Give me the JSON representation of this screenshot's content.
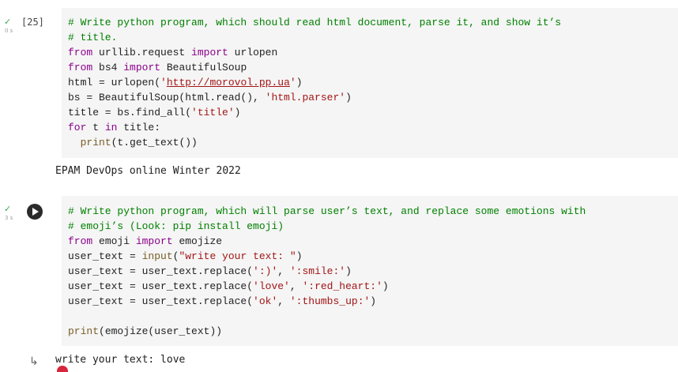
{
  "cell1": {
    "status_icon": "check-icon",
    "exec_time": "0 s",
    "exec_count": "[25]",
    "code": [
      [
        [
          "cm",
          "# Write python program, which should read html document, parse it, and show it’s"
        ]
      ],
      [
        [
          "cm",
          "# title."
        ]
      ],
      [
        [
          "kw",
          "from"
        ],
        [
          "",
          " urllib.request "
        ],
        [
          "kw",
          "import"
        ],
        [
          "",
          " urlopen"
        ]
      ],
      [
        [
          "kw",
          "from"
        ],
        [
          "",
          " bs4 "
        ],
        [
          "kw",
          "import"
        ],
        [
          "",
          " BeautifulSoup"
        ]
      ],
      [
        [
          "",
          "html = urlopen("
        ],
        [
          "st",
          "'"
        ],
        [
          "url",
          "http://morovol.pp.ua"
        ],
        [
          "st",
          "'"
        ],
        [
          "",
          ")"
        ]
      ],
      [
        [
          "",
          "bs = BeautifulSoup(html.read(), "
        ],
        [
          "st",
          "'html.parser'"
        ],
        [
          "",
          ")"
        ]
      ],
      [
        [
          "",
          "title = bs.find_all("
        ],
        [
          "st",
          "'title'"
        ],
        [
          "",
          ")"
        ]
      ],
      [
        [
          "kw",
          "for"
        ],
        [
          "",
          " t "
        ],
        [
          "kw",
          "in"
        ],
        [
          "",
          " title:"
        ]
      ],
      [
        [
          "",
          "  "
        ],
        [
          "bi",
          "print"
        ],
        [
          "",
          "(t.get_text())"
        ]
      ]
    ],
    "output": "EPAM DevOps online Winter 2022"
  },
  "cell2": {
    "status_icon": "check-icon",
    "exec_time": "3 s",
    "run_icon": "play-icon",
    "code": [
      [
        [
          "cm",
          "# Write python program, which will parse user’s text, and replace some emotions with"
        ]
      ],
      [
        [
          "cm",
          "# emoji’s (Look: pip install emoji)"
        ]
      ],
      [
        [
          "kw",
          "from"
        ],
        [
          "",
          " emoji "
        ],
        [
          "kw",
          "import"
        ],
        [
          "",
          " emojize"
        ]
      ],
      [
        [
          "",
          "user_text = "
        ],
        [
          "bi",
          "input"
        ],
        [
          "",
          "("
        ],
        [
          "st",
          "\"write your text: \""
        ],
        [
          "",
          ")"
        ]
      ],
      [
        [
          "",
          "user_text = user_text.replace("
        ],
        [
          "st",
          "':)'"
        ],
        [
          "",
          ", "
        ],
        [
          "st",
          "':smile:'"
        ],
        [
          "",
          ")"
        ]
      ],
      [
        [
          "",
          "user_text = user_text.replace("
        ],
        [
          "st",
          "'love'"
        ],
        [
          "",
          ", "
        ],
        [
          "st",
          "':red_heart:'"
        ],
        [
          "",
          ")"
        ]
      ],
      [
        [
          "",
          "user_text = user_text.replace("
        ],
        [
          "st",
          "'ok'"
        ],
        [
          "",
          ", "
        ],
        [
          "st",
          "':thumbs_up:'"
        ],
        [
          "",
          ")"
        ]
      ],
      [
        [
          "",
          ""
        ]
      ],
      [
        [
          "bi",
          "print"
        ],
        [
          "",
          "(emojize(user_text))"
        ]
      ]
    ],
    "output_icon": "output-arrow-icon",
    "output": "write your text: love",
    "output_emoji": "red-heart-icon"
  }
}
